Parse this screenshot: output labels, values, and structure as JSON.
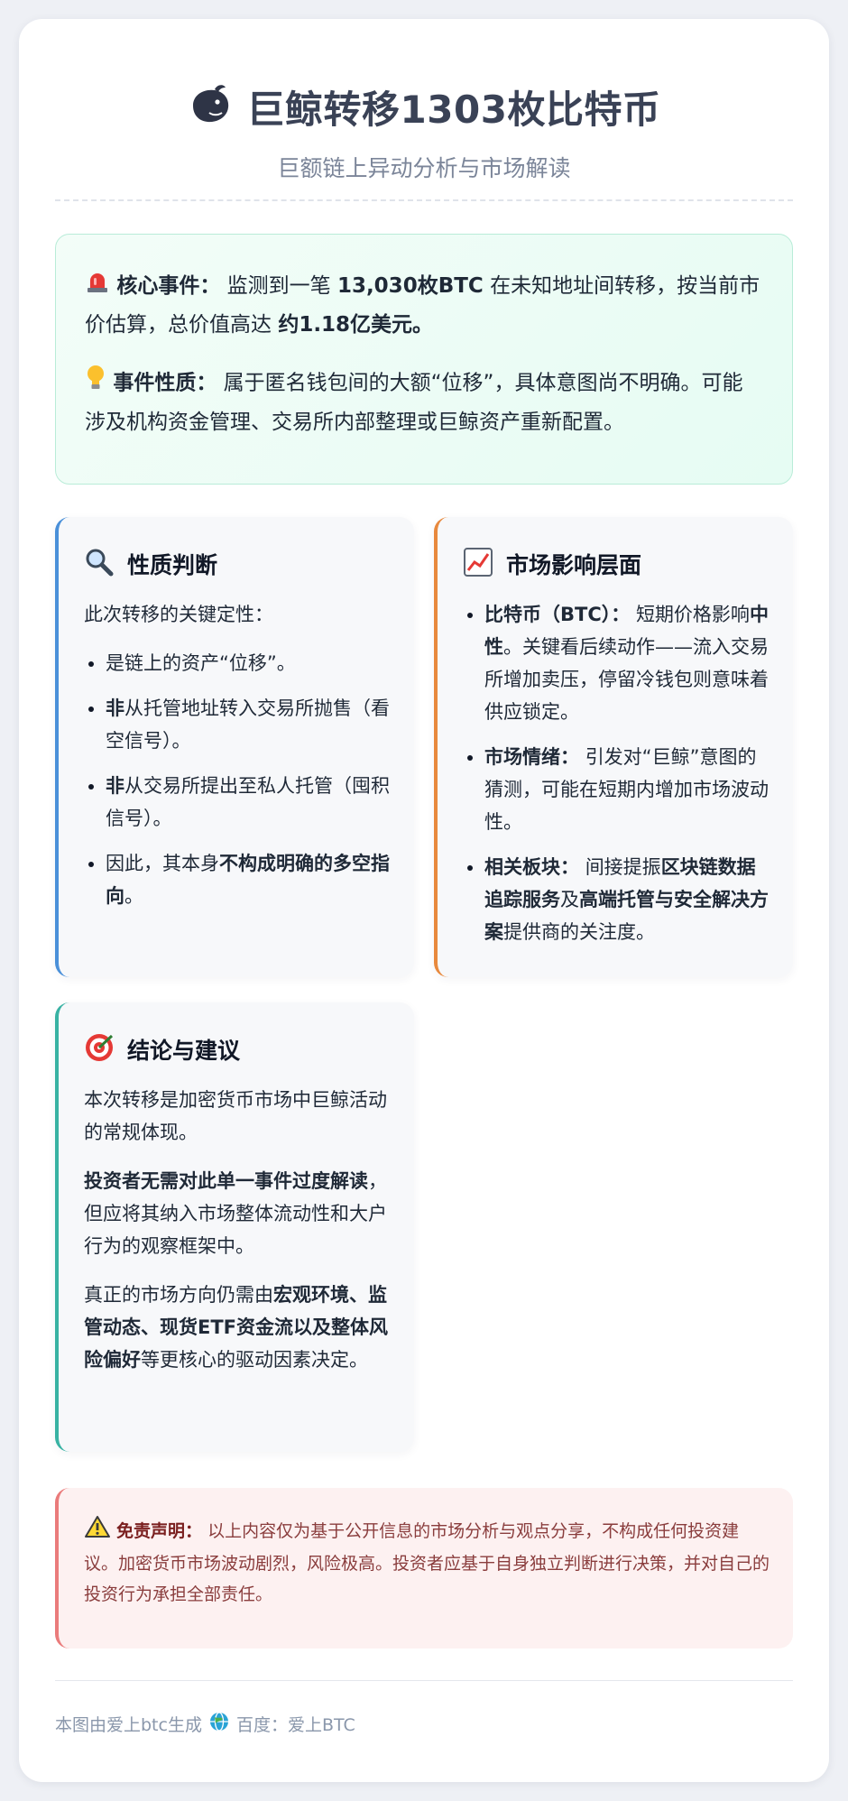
{
  "header": {
    "title": "巨鲸转移1303枚比特币",
    "subtitle": "巨额链上异动分析与市场解读"
  },
  "event": {
    "core_label": "核心事件：",
    "core_pre": "监测到一笔",
    "core_amount": "13,030枚BTC",
    "core_mid": "在未知地址间转移，按当前市价估算，总价值高达",
    "core_value": "约1.18亿美元。",
    "nature_label": "事件性质：",
    "nature_text": "属于匿名钱包间的大额“位移”，具体意图尚不明确。可能涉及机构资金管理、交易所内部整理或巨鲸资产重新配置。"
  },
  "panel_nature": {
    "title": "性质判断",
    "intro": "此次转移的关键定性：",
    "items": [
      {
        "pre": "",
        "bold": "",
        "post": "是链上的资产“位移”。"
      },
      {
        "pre": "",
        "bold": "非",
        "post": "从托管地址转入交易所抛售（看空信号）。"
      },
      {
        "pre": "",
        "bold": "非",
        "post": "从交易所提出至私人托管（囤积信号）。"
      },
      {
        "pre": "因此，其本身",
        "bold": "不构成明确的多空指向",
        "post": "。"
      }
    ]
  },
  "panel_market": {
    "title": "市场影响层面",
    "items": [
      {
        "label": "比特币（BTC）：",
        "t1": "短期价格影响",
        "b1": "中性",
        "t2": "。关键看后续动作——流入交易所增加卖压，停留冷钱包则意味着供应锁定。",
        "b2": "",
        "t3": ""
      },
      {
        "label": "市场情绪：",
        "t1": "引发对“巨鲸”意图的猜测，可能在短期内增加市场波动性。",
        "b1": "",
        "t2": "",
        "b2": "",
        "t3": ""
      },
      {
        "label": "相关板块：",
        "t1": "间接提振",
        "b1": "区块链数据追踪服务",
        "t2": "及",
        "b2": "高端托管与安全解决方案",
        "t3": "提供商的关注度。"
      }
    ]
  },
  "panel_conclusion": {
    "title": "结论与建议",
    "p1": "本次转移是加密货币市场中巨鲸活动的常规体现。",
    "p2_bold": "投资者无需对此单一事件过度解读",
    "p2_rest": "，但应将其纳入市场整体流动性和大户行为的观察框架中。",
    "p3_pre": "真正的市场方向仍需由",
    "p3_bold": "宏观环境、监管动态、现货ETF资金流以及整体风险偏好",
    "p3_post": "等更核心的驱动因素决定。"
  },
  "disclaimer": {
    "label": "免责声明：",
    "text": "以上内容仅为基于公开信息的市场分析与观点分享，不构成任何投资建议。加密货币市场波动剧烈，风险极高。投资者应基于自身独立判断进行决策，并对自己的投资行为承担全部责任。"
  },
  "footer": {
    "generated": "本图由爱上btc生成",
    "source": "百度：爱上BTC"
  },
  "colors": {
    "accent_blue": "#4a90d9",
    "accent_orange": "#e8893d",
    "accent_teal": "#38b2a3",
    "accent_red": "#ea7b7b"
  },
  "icons": [
    "whale-icon",
    "siren-icon",
    "lightbulb-icon",
    "magnifier-icon",
    "chart-icon",
    "target-icon",
    "warning-icon",
    "globe-icon"
  ]
}
